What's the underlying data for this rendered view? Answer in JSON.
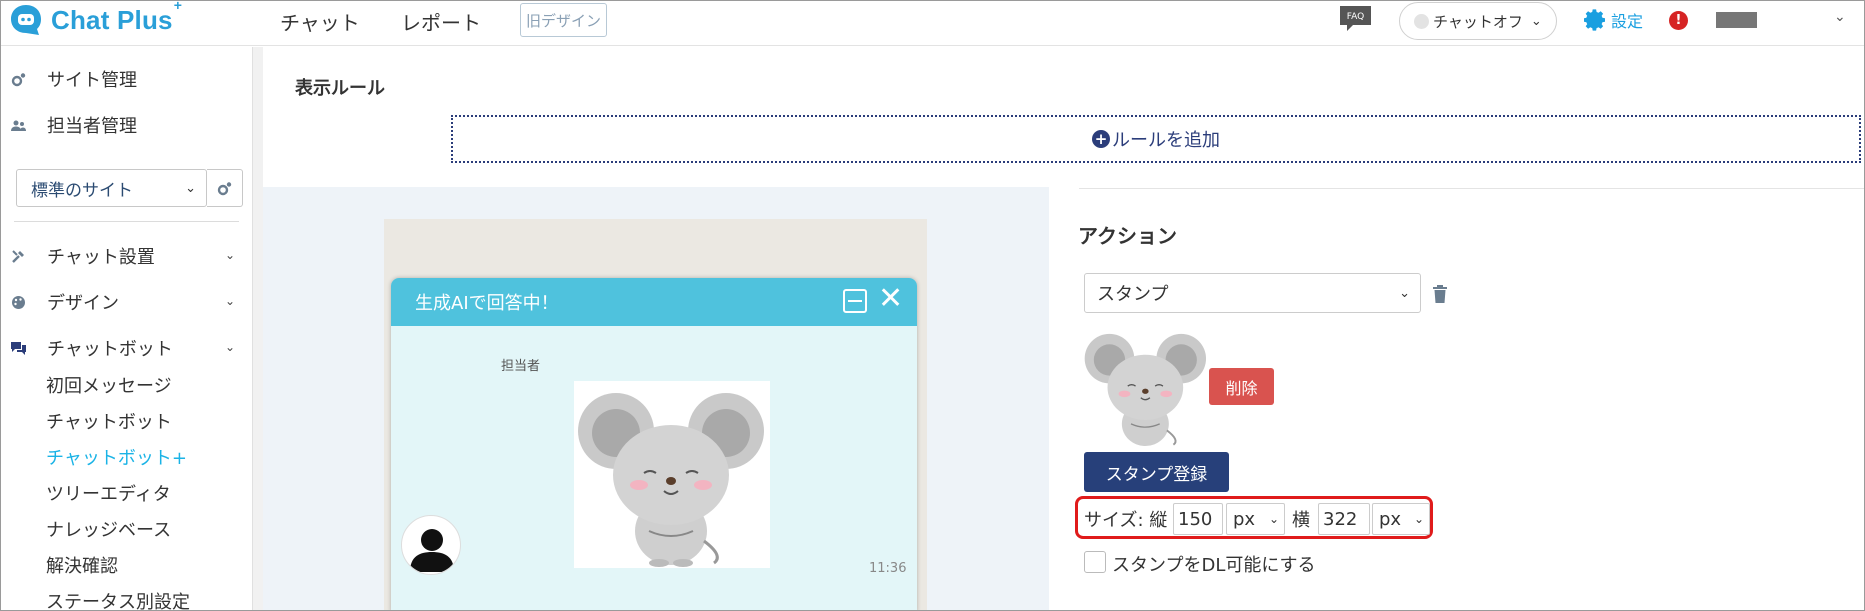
{
  "header": {
    "logo_text": "Chat Plus",
    "logo_sup": "+",
    "nav": {
      "chat": "チャット",
      "report": "レポート"
    },
    "old_design": "旧デザイン",
    "faq": "FAQ",
    "chat_status": "チャットオフ",
    "settings": "設定",
    "alert": "!"
  },
  "sidebar": {
    "site_admin": "サイト管理",
    "staff_admin": "担当者管理",
    "site_select": "標準のサイト",
    "chat_setup": "チャット設置",
    "design": "デザイン",
    "chatbot": "チャットボット",
    "sub": {
      "first_message": "初回メッセージ",
      "chatbot": "チャットボット",
      "chatbot_plus": "チャットボット+",
      "tree_editor": "ツリーエディタ",
      "knowledge": "ナレッジベース",
      "resolve": "解決確認",
      "status": "ステータス別設定"
    }
  },
  "main": {
    "rule_title": "表示ルール",
    "add_rule": "ルールを追加",
    "preview": {
      "header": "生成AIで回答中！",
      "agent_label": "担当者",
      "time": "11:36"
    },
    "action": {
      "title": "アクション",
      "selected": "スタンプ",
      "delete": "削除",
      "register": "スタンプ登録",
      "size_label": "サイズ: 縦",
      "height": "150",
      "height_unit": "px",
      "width_label": "横",
      "width": "322",
      "width_unit": "px",
      "dl_label": "スタンプをDL可能にする"
    }
  },
  "colors": {
    "brand": "#2a9fd8",
    "active_nav": "#1ab3e6",
    "chat_header": "#4fc2dd",
    "delete": "#d9534f",
    "primary": "#27407a",
    "highlight": "#e01b1b"
  }
}
